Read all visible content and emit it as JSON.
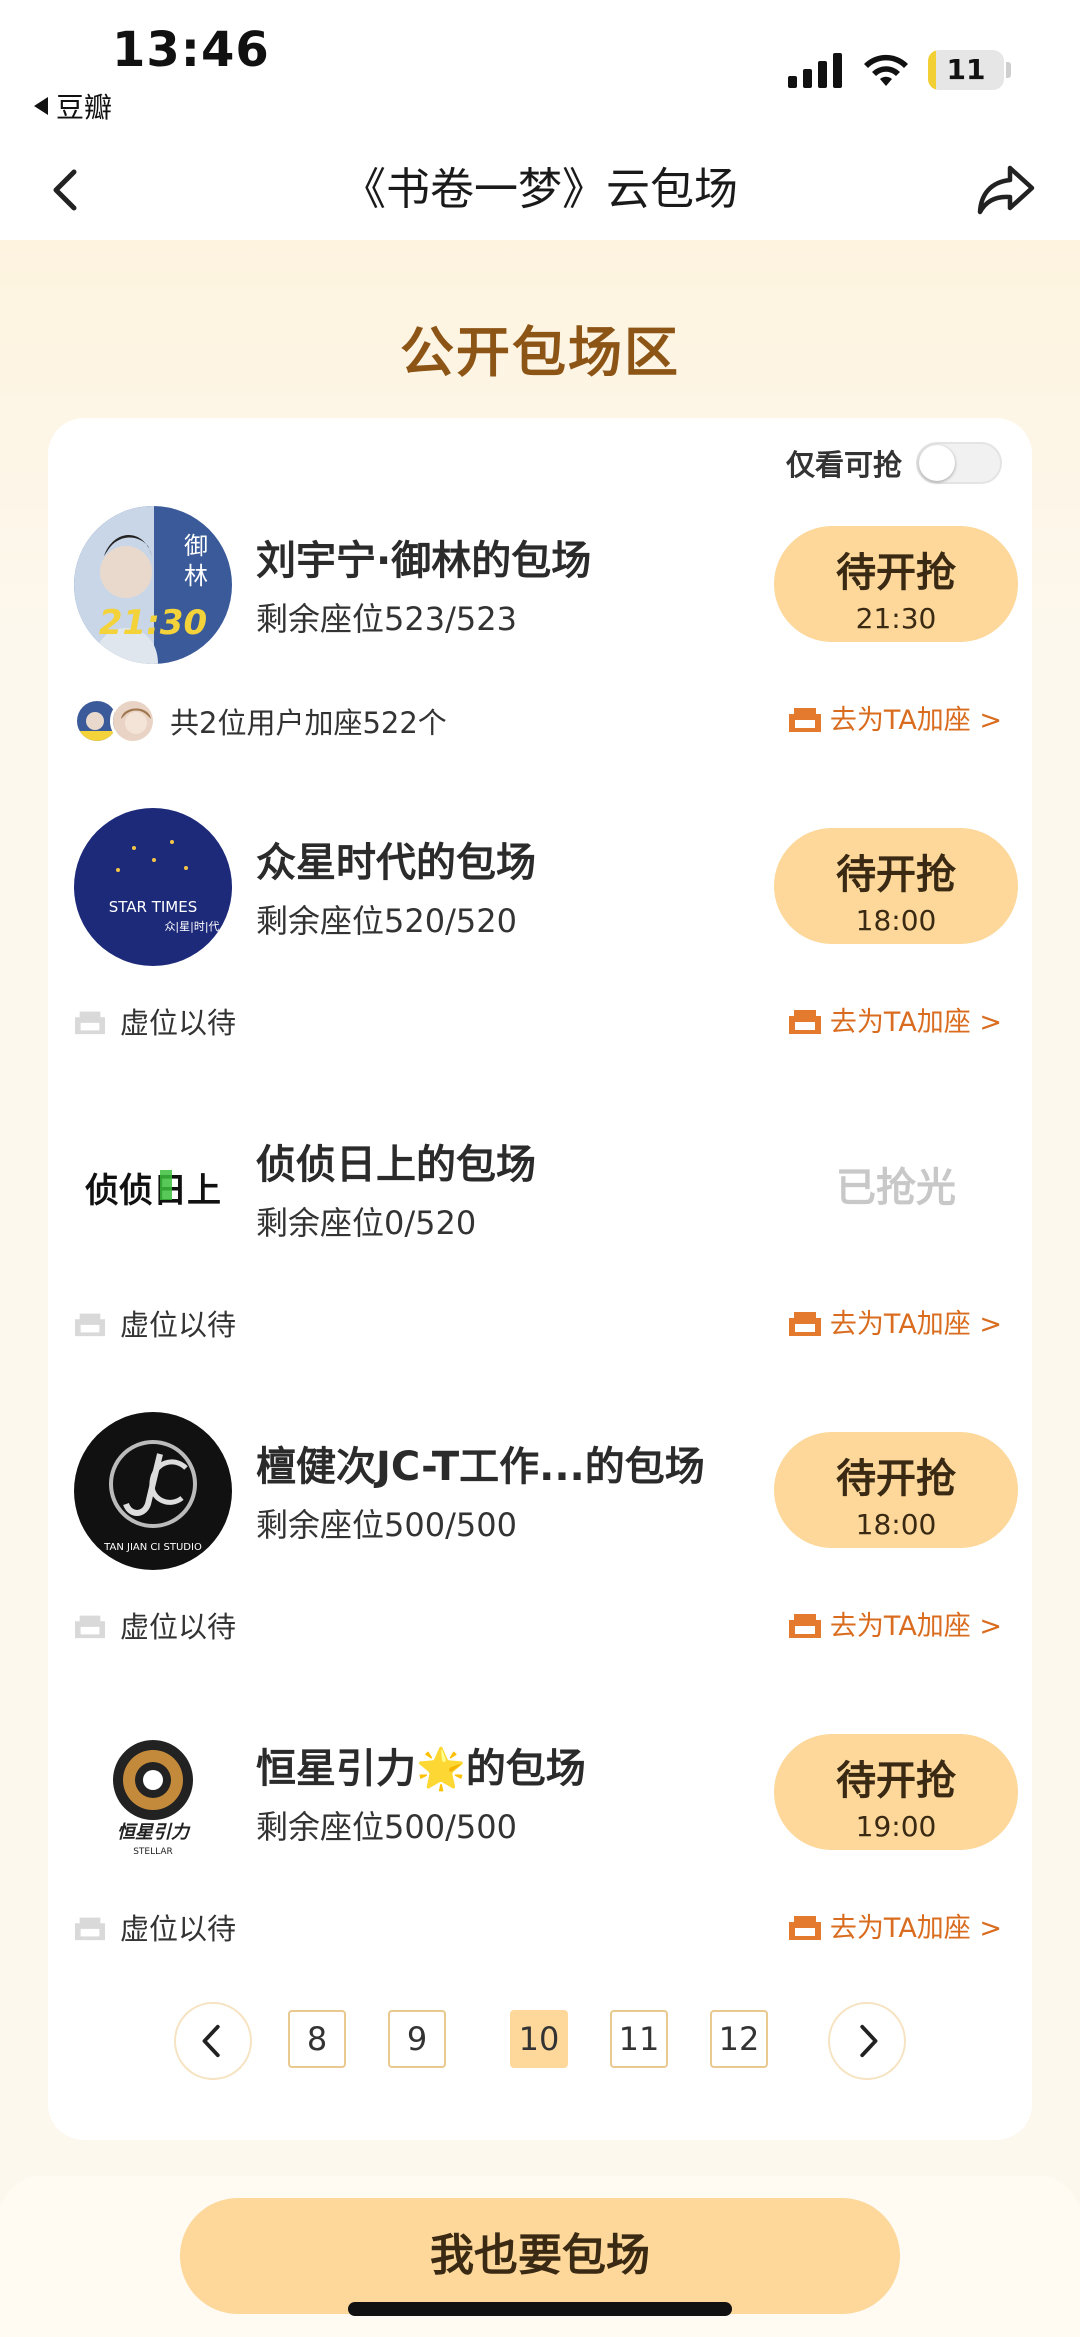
{
  "status": {
    "time": "13:46",
    "back_app": "豆瓣",
    "battery": "11",
    "battery_level": 0.11
  },
  "nav": {
    "title": "《书卷一梦》云包场"
  },
  "section_title": "公开包场区",
  "filter": {
    "label": "仅看可抢",
    "enabled": false
  },
  "items": [
    {
      "name": "刘宇宁·御林的包场",
      "seats": "剩余座位523/523",
      "status": "待开抢",
      "time": "21:30",
      "joined": "共2位用户加座522个",
      "action": "去为TA加座 >",
      "avatar_text_1": "御",
      "avatar_text_2": "林",
      "avatar_time": "21:30"
    },
    {
      "name": "众星时代的包场",
      "seats": "剩余座位520/520",
      "status": "待开抢",
      "time": "18:00",
      "waiting": "虚位以待",
      "action": "去为TA加座 >",
      "avatar_text": "STAR TIMES",
      "avatar_sub": "众|星|时|代"
    },
    {
      "name": "侦侦日上的包场",
      "seats": "剩余座位0/520",
      "status": "已抢光",
      "waiting": "虚位以待",
      "action": "去为TA加座 >",
      "avatar_text": "侦侦日上"
    },
    {
      "name": "檀健次JC-T工作...的包场",
      "seats": "剩余座位500/500",
      "status": "待开抢",
      "time": "18:00",
      "waiting": "虚位以待",
      "action": "去为TA加座 >",
      "avatar_text": "TAN JIAN CI STUDIO"
    },
    {
      "name_prefix": "恒星引力",
      "name_suffix": "的包场",
      "name_emoji": "🌟",
      "seats": "剩余座位500/500",
      "status": "待开抢",
      "time": "19:00",
      "waiting": "虚位以待",
      "action": "去为TA加座 >",
      "avatar_text": "恒星引力",
      "avatar_sub": "STELLAR"
    }
  ],
  "pager": {
    "pages": [
      "8",
      "9",
      "10",
      "11",
      "12"
    ],
    "active": "10"
  },
  "bottom_button": "我也要包场",
  "colors": {
    "accent": "#fdd89a",
    "title_brown": "#8c5516",
    "action_orange": "#d96c1f"
  },
  "icons": [
    "back-chevron-icon",
    "share-icon",
    "seat-icon",
    "chevron-left-icon",
    "chevron-right-icon"
  ]
}
